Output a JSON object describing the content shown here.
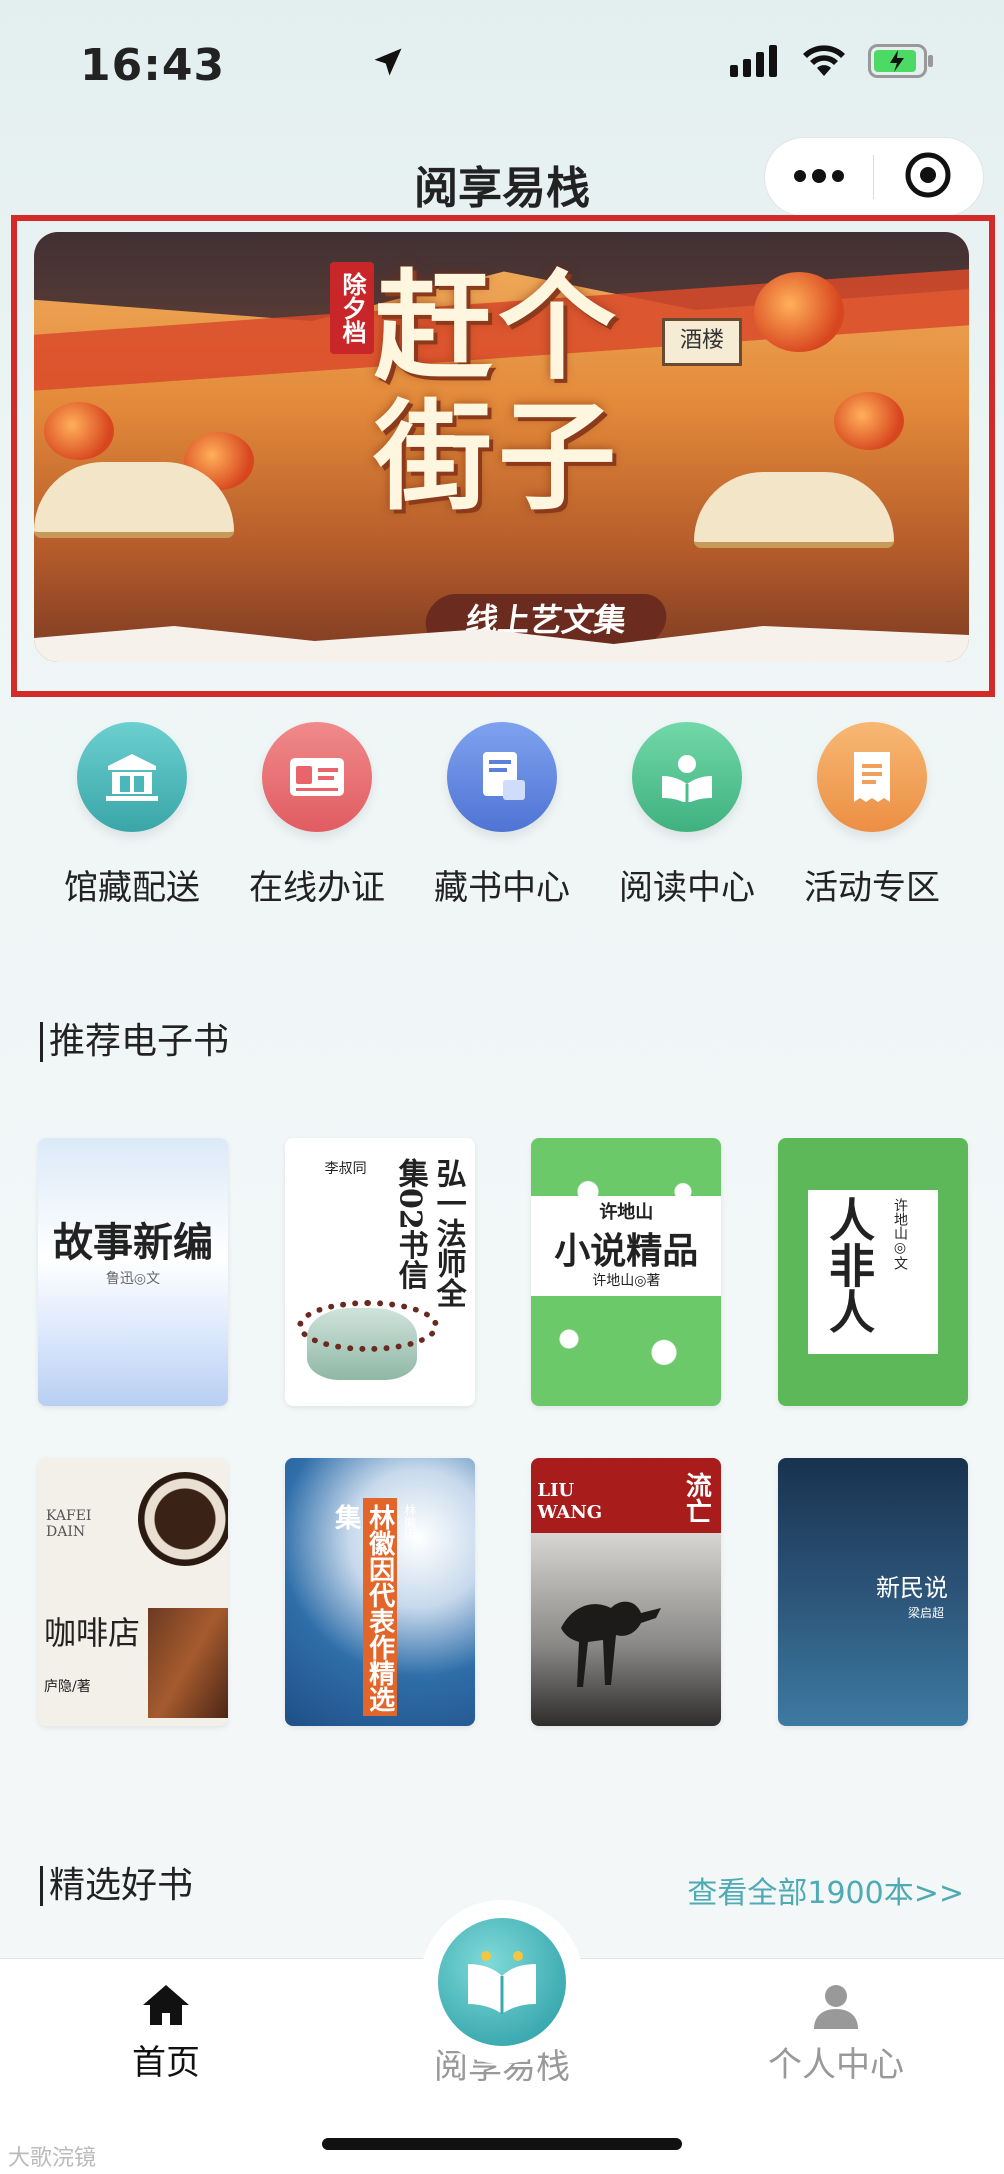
{
  "status_bar": {
    "time": "16:43"
  },
  "header": {
    "title": "阅享易栈"
  },
  "banner": {
    "tag": "除夕档",
    "title": "赶个街子",
    "subtitle": "线上艺文集",
    "sign": "酒楼"
  },
  "quick_entries": [
    {
      "label": "馆藏配送",
      "icon": "library-icon",
      "color": "#4ab7b8"
    },
    {
      "label": "在线办证",
      "icon": "id-card-icon",
      "color": "#e9656a"
    },
    {
      "label": "藏书中心",
      "icon": "book-stack-icon",
      "color": "#5a80db"
    },
    {
      "label": "阅读中心",
      "icon": "reader-icon",
      "color": "#4cbf8d"
    },
    {
      "label": "活动专区",
      "icon": "receipt-icon",
      "color": "#f0a05a"
    }
  ],
  "sections": {
    "ebooks_title": "推荐电子书",
    "picks_title": "精选好书",
    "view_all": "查看全部1900本>>"
  },
  "ebooks": [
    {
      "title": "故事新编",
      "author": "鲁迅◎文"
    },
    {
      "title": "弘一法师全集02书信",
      "author": "李叔同"
    },
    {
      "title": "小说精品",
      "author": "许地山◎著",
      "kicker": "许地山"
    },
    {
      "title": "人非人",
      "author": "许地山◎文"
    },
    {
      "title": "咖啡店",
      "author": "庐隐/著",
      "kicker": "KAFEI DAIN"
    },
    {
      "title": "林徽因代表作精选集",
      "author": "林徽因"
    },
    {
      "title": "流亡",
      "author": "",
      "kicker": "LIU WANG"
    },
    {
      "title": "新民说",
      "author": "梁启超"
    }
  ],
  "tabbar": {
    "home": "首页",
    "center": "阅享易栈",
    "profile": "个人中心"
  },
  "watermark": "大歌浣镜"
}
